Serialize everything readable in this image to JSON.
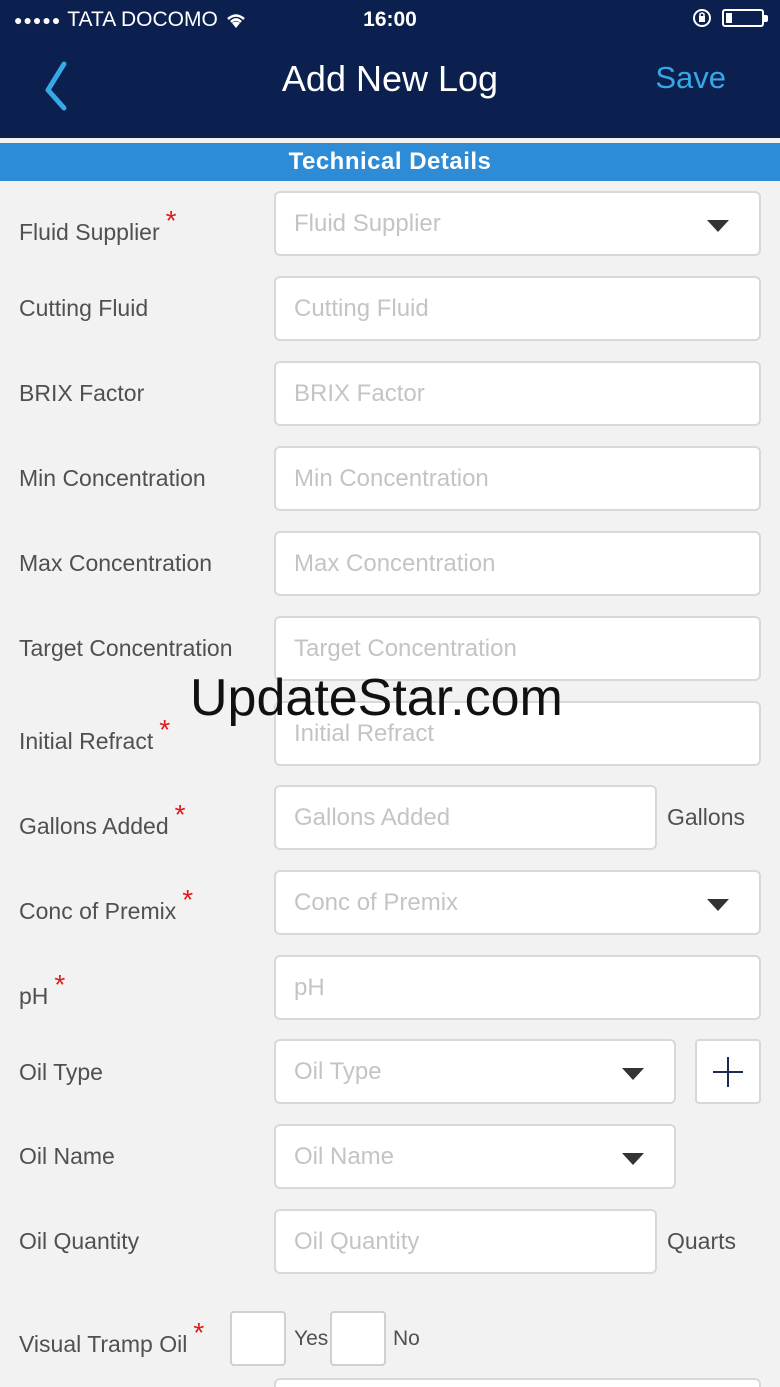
{
  "status_bar": {
    "carrier": "TATA DOCOMO",
    "time": "16:00"
  },
  "navbar": {
    "title": "Add New Log",
    "save_label": "Save"
  },
  "section": {
    "title": "Technical  Details"
  },
  "fields": {
    "fluid_supplier": {
      "label": "Fluid Supplier",
      "required": "*",
      "placeholder": "Fluid Supplier"
    },
    "cutting_fluid": {
      "label": "Cutting Fluid",
      "placeholder": "Cutting Fluid"
    },
    "brix_factor": {
      "label": "BRIX Factor",
      "placeholder": "BRIX Factor"
    },
    "min_concentration": {
      "label": "Min Concentration",
      "placeholder": "Min Concentration"
    },
    "max_concentration": {
      "label": "Max Concentration",
      "placeholder": "Max Concentration"
    },
    "target_concentration": {
      "label": "Target Concentration",
      "placeholder": "Target Concentration"
    },
    "initial_refract": {
      "label": "Initial Refract",
      "required": "*",
      "placeholder": "Initial Refract"
    },
    "gallons_added": {
      "label": "Gallons Added",
      "required": "*",
      "placeholder": "Gallons Added",
      "unit": "Gallons"
    },
    "conc_of_premix": {
      "label": "Conc of Premix",
      "required": "*",
      "placeholder": "Conc of Premix"
    },
    "ph": {
      "label": "pH",
      "required": "*",
      "placeholder": "pH"
    },
    "oil_type": {
      "label": "Oil Type",
      "placeholder": "Oil Type"
    },
    "oil_name": {
      "label": "Oil Name",
      "placeholder": "Oil Name"
    },
    "oil_quantity": {
      "label": "Oil Quantity",
      "placeholder": "Oil Quantity",
      "unit": "Quarts"
    },
    "visual_tramp_oil": {
      "label": "Visual Tramp Oil",
      "required": "*",
      "yes_label": "Yes",
      "no_label": "No"
    }
  },
  "watermark": "UpdateStar.com"
}
